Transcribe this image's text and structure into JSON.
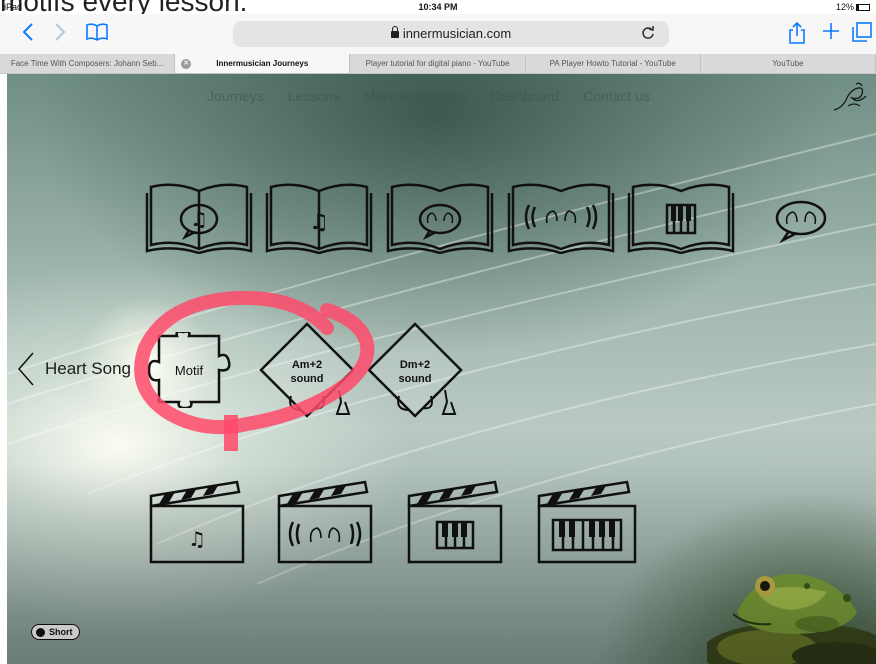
{
  "caption": "motifs every lesson.",
  "statusbar": {
    "device": "iPad",
    "time": "10:34 PM",
    "battery": "12%"
  },
  "toolbar": {
    "back_icon": "chevron-left-icon",
    "forward_icon": "chevron-right-icon",
    "bookmarks_icon": "book-icon",
    "url": "innermusician.com",
    "reload_icon": "reload-icon",
    "share_icon": "share-icon",
    "new_tab_icon": "plus-icon",
    "tabs_icon": "tabs-icon"
  },
  "tabs": [
    {
      "label": "Face Time With Composers: Johann Seb..."
    },
    {
      "label": "Innermusician Journeys"
    },
    {
      "label": "Player tutorial for digital piano - YouTube"
    },
    {
      "label": "PA Player Howto Tutorial - YouTube"
    },
    {
      "label": "YouTube"
    }
  ],
  "site_nav": [
    "Journeys",
    "Lessons",
    "More Resources",
    "Dashboard",
    "Contact us"
  ],
  "heart_song": {
    "label": "Heart Song"
  },
  "puzzle": {
    "label": "Motif"
  },
  "diamonds": [
    {
      "line1": "Am+2",
      "line2": "sound"
    },
    {
      "line1": "Dm+2",
      "line2": "sound"
    }
  ],
  "top_row_icons": [
    "book-speech-notes-icon",
    "book-note-icon",
    "book-speech-hands-icon",
    "book-sound-hands-icon",
    "book-piano-icon",
    "speech-hands-icon"
  ],
  "bottom_row_icons": [
    "clapper-note-icon",
    "clapper-sound-hands-icon",
    "clapper-piano-small-icon",
    "clapper-piano-large-icon"
  ],
  "toggle": {
    "label": "Short"
  },
  "colors": {
    "accent": "#0a7aff",
    "highlight_circle": "#ff4a6a"
  }
}
